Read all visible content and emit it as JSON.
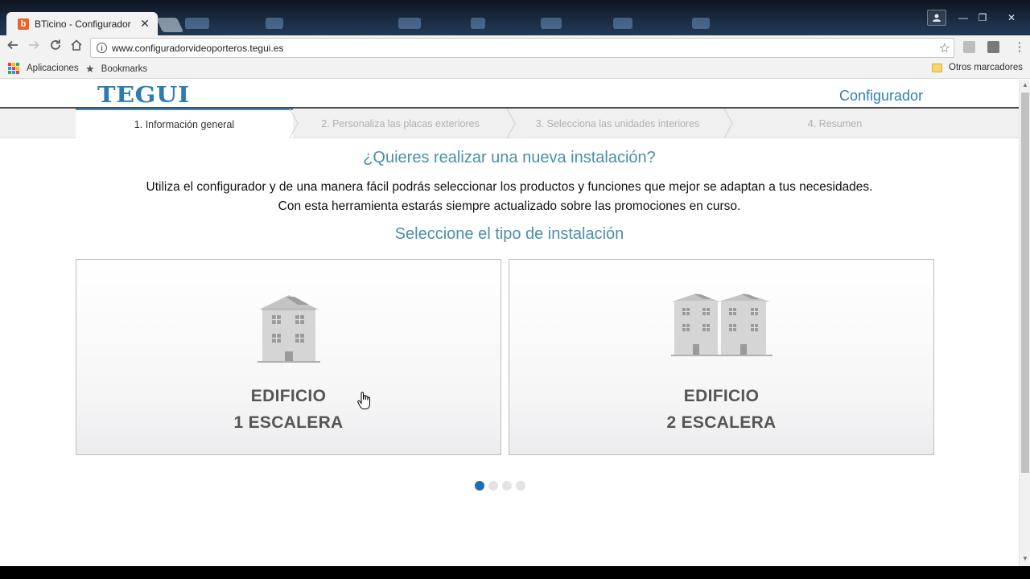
{
  "browser": {
    "tab_title": "BTicino - Configurador",
    "tab_favicon": "b",
    "url": "www.configuradorvideoporteros.tegui.es",
    "bookmarks": {
      "apps_label": "Aplicaciones",
      "bookmarks_label": "Bookmarks",
      "other_label": "Otros marcadores"
    }
  },
  "header": {
    "logo": "TEGUI",
    "section_title": "Configurador"
  },
  "steps": [
    {
      "label": "1. Información general",
      "active": true
    },
    {
      "label": "2. Personaliza las placas exteriores",
      "active": false
    },
    {
      "label": "3. Selecciona las unidades interiores",
      "active": false
    },
    {
      "label": "4. Resumen",
      "active": false
    }
  ],
  "main": {
    "question": "¿Quieres realizar una nueva instalación?",
    "description_line1": "Utiliza el configurador y de una manera fácil podrás seleccionar los productos y funciones que mejor se adaptan a tus necesidades.",
    "description_line2": "Con esta herramienta estarás siempre actualizado sobre las promociones en curso.",
    "select_title": "Seleccione el tipo de instalación",
    "options": [
      {
        "line1": "EDIFICIO",
        "line2": "1 ESCALERA",
        "icon": "building-icon"
      },
      {
        "line1": "EDIFICIO",
        "line2": "2 ESCALERA",
        "icon": "two-buildings-icon"
      }
    ],
    "pagination": {
      "pages": 4,
      "current": 1
    }
  },
  "colors": {
    "accent": "#2f7fb3",
    "heading": "#4a8fa8",
    "dot_active": "#1f6fae",
    "dot_inactive": "#e3e3e3"
  }
}
